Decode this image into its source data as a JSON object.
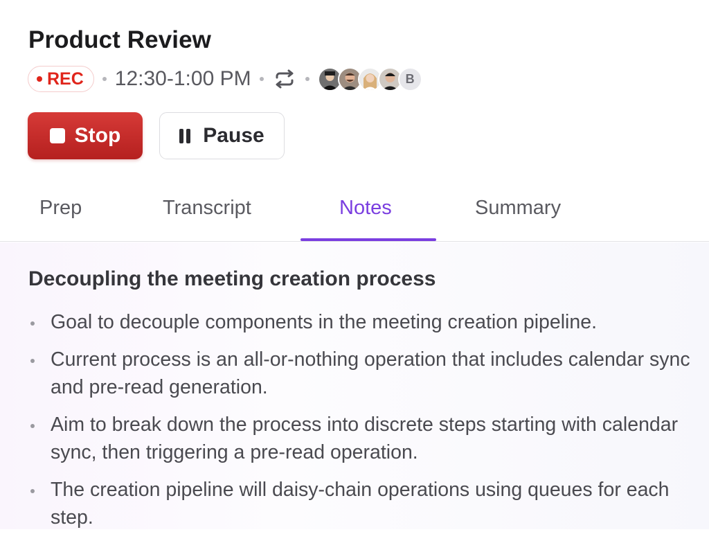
{
  "meeting": {
    "title": "Product Review",
    "rec_label": "REC",
    "time_range": "12:30-1:00 PM",
    "recurring_icon": "repeat-icon",
    "participants": [
      {
        "kind": "photo",
        "color": "#3a3a3a"
      },
      {
        "kind": "photo",
        "color": "#8a6a58"
      },
      {
        "kind": "photo",
        "color": "#d8b48a"
      },
      {
        "kind": "photo",
        "color": "#2a2a2a"
      },
      {
        "kind": "initial",
        "initial": "B"
      }
    ]
  },
  "controls": {
    "stop_label": "Stop",
    "pause_label": "Pause",
    "stop_color": "#c62b29"
  },
  "tabs": [
    {
      "label": "Prep",
      "active": false
    },
    {
      "label": "Transcript",
      "active": false
    },
    {
      "label": "Notes",
      "active": true
    },
    {
      "label": "Summary",
      "active": false
    }
  ],
  "accent_color": "#7a3ee0",
  "notes": {
    "heading": "Decoupling the meeting creation process",
    "bullets": [
      "Goal to decouple components in the meeting creation pipeline.",
      "Current process is an all-or-nothing operation that includes calendar sync and pre-read generation.",
      "Aim to break down the process into discrete steps starting with calendar sync, then triggering a pre-read operation.",
      "The creation pipeline will daisy-chain operations using queues for each step."
    ]
  }
}
